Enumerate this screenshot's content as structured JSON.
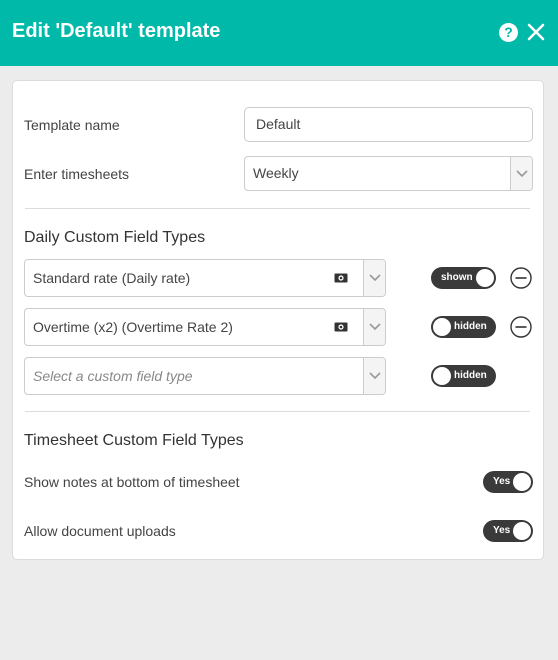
{
  "header": {
    "title": "Edit 'Default' template",
    "help_label": "?"
  },
  "form": {
    "template_name_label": "Template name",
    "template_name_value": "Default",
    "enter_timesheets_label": "Enter timesheets",
    "enter_timesheets_value": "Weekly"
  },
  "daily_section": {
    "title": "Daily Custom Field Types",
    "rows": [
      {
        "value": "Standard rate (Daily rate)",
        "toggle": "shown"
      },
      {
        "value": "Overtime (x2) (Overtime Rate 2)",
        "toggle": "hidden"
      }
    ],
    "new_row": {
      "placeholder": "Select a custom field type",
      "toggle": "hidden"
    }
  },
  "timesheet_section": {
    "title": "Timesheet Custom Field Types",
    "options": [
      {
        "label": "Show notes at bottom of timesheet",
        "toggle": "Yes"
      },
      {
        "label": "Allow document uploads",
        "toggle": "Yes"
      }
    ]
  },
  "colors": {
    "header": "#00b9a8",
    "toggle": "#3a3a3a"
  }
}
